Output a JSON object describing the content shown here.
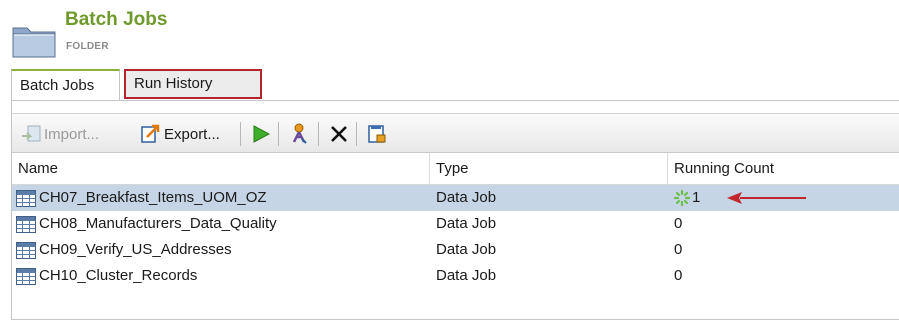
{
  "header": {
    "title": "Batch Jobs",
    "subtitle": "FOLDER",
    "icon": "folder-icon"
  },
  "tabs": [
    {
      "label": "Batch Jobs",
      "active": true
    },
    {
      "label": "Run History",
      "active": false,
      "highlighted": true
    }
  ],
  "toolbar": {
    "import_label": "Import...",
    "export_label": "Export...",
    "run_icon": "play-icon",
    "schedule_icon": "job-key-icon",
    "delete_icon": "delete-x-icon",
    "properties_icon": "job-log-icon"
  },
  "table": {
    "columns": [
      "Name",
      "Type",
      "Running Count"
    ],
    "rows": [
      {
        "name": "CH07_Breakfast_Items_UOM_OZ",
        "type": "Data Job",
        "running_count": "1",
        "running": true,
        "selected": true
      },
      {
        "name": "CH08_Manufacturers_Data_Quality",
        "type": "Data Job",
        "running_count": "0",
        "running": false,
        "selected": false
      },
      {
        "name": "CH09_Verify_US_Addresses",
        "type": "Data Job",
        "running_count": "0",
        "running": false,
        "selected": false
      },
      {
        "name": "CH10_Cluster_Records",
        "type": "Data Job",
        "running_count": "0",
        "running": false,
        "selected": false
      }
    ]
  },
  "colors": {
    "title": "#6f9a2c",
    "highlight_border": "#b3252a",
    "selected_row": "#c6d5e6",
    "arrow": "#c0262c",
    "running_icon": "#6cc04a"
  }
}
